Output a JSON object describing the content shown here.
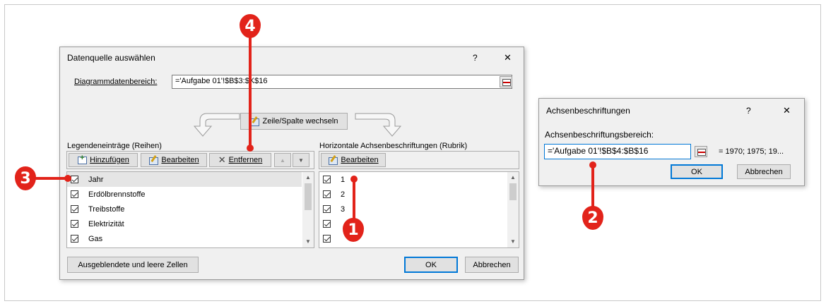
{
  "main_dialog": {
    "title": "Datenquelle auswählen",
    "help": "?",
    "close": "✕",
    "range_label": "Diagrammdatenbereich:",
    "range_value": "='Aufgabe 01'!$B$3:$K$16",
    "switch_button": "Zeile/Spalte wechseln",
    "legend_section_label": "Legendeneinträge (Reihen)",
    "axis_section_label": "Horizontale Achsenbeschriftungen (Rubrik)",
    "legend_toolbar": {
      "add": "Hinzufügen",
      "edit": "Bearbeiten",
      "remove": "Entfernen",
      "up": "▲",
      "down": "▼"
    },
    "axis_toolbar": {
      "edit": "Bearbeiten"
    },
    "legend_items": [
      "Jahr",
      "Erdölbrennstoffe",
      "Treibstoffe",
      "Elektrizität",
      "Gas"
    ],
    "axis_items": [
      "1",
      "2",
      "3",
      "",
      ""
    ],
    "hidden_cells_button": "Ausgeblendete und leere Zellen",
    "ok": "OK",
    "cancel": "Abbrechen"
  },
  "axis_dialog": {
    "title": "Achsenbeschriftungen",
    "help": "?",
    "close": "✕",
    "range_label": "Achsenbeschriftungsbereich:",
    "range_value": "='Aufgabe 01'!$B$4:$B$16",
    "preview": "= 1970; 1975; 19...",
    "ok": "OK",
    "cancel": "Abbrechen"
  },
  "markers": [
    "1",
    "2",
    "3",
    "4"
  ],
  "colors": {
    "marker": "#e2231a",
    "selection": "#e5e5e5",
    "dialog_bg": "#f0f0f0"
  }
}
